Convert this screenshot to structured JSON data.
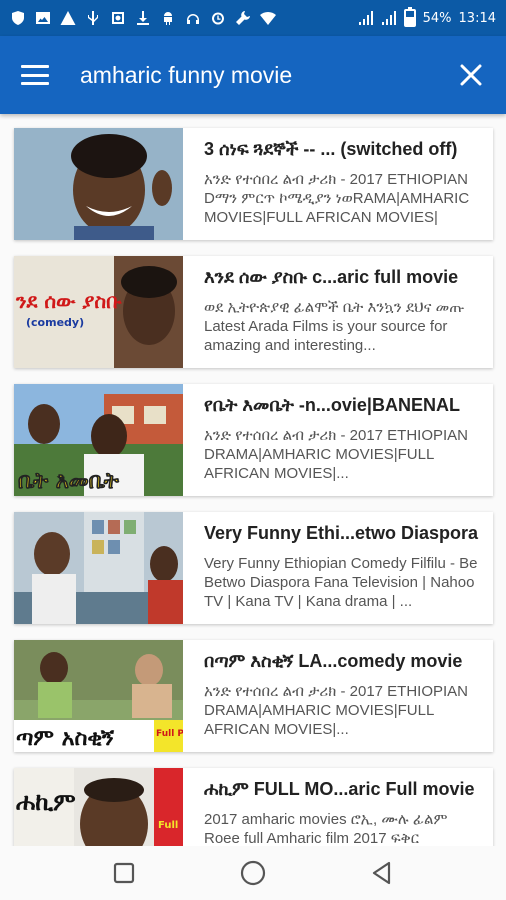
{
  "status_bar": {
    "battery_percent": "54%",
    "time": "13:14",
    "battery_level": 0.54,
    "icons": [
      "shield-icon",
      "image-icon",
      "warning-icon",
      "usb-icon",
      "instagram-icon",
      "download-icon",
      "android-icon",
      "headphones-icon",
      "alarm-icon",
      "wrench-icon",
      "wifi-icon",
      "signal-icon",
      "signal-icon",
      "charging-icon"
    ]
  },
  "app_bar": {
    "search_value": "amharic funny movie",
    "colors": {
      "status": "#0c5aa6",
      "bar": "#1565c0"
    }
  },
  "results": [
    {
      "title": "3 ሰነፍ ጓደኞች -- ... (switched off)",
      "description": "አንድ የተሰበረ ልብ ታሪክ - 2017 ETHIOPIAN Dማን ምርጥ ኮሜዲያን ነወRAMA|AMHARIC MOVIES|FULL AFRICAN MOVIES|",
      "thumb_overlay": ""
    },
    {
      "title": "እንደ ሰው ያስቡ c...aric full movie",
      "description": "ወደ ኢትዮጵያዊ ፊልሞች ቤት እንኳን ደህና መጡ Latest Arada Films is your source for amazing and interesting...",
      "thumb_overlay": "ንደ ሰው ያስቡ",
      "thumb_sub": "(comedy)"
    },
    {
      "title": "የቤት እመቤት -n...ovie|BANENAL",
      "description": "አንድ የተሰበረ ልብ ታሪክ - 2017 ETHIOPIAN DRAMA|AMHARIC MOVIES|FULL AFRICAN MOVIES|...",
      "thumb_overlay": "ቤት እመቤት"
    },
    {
      "title": "Very Funny Ethi...etwo Diaspora",
      "description": "Very Funny Ethiopian Comedy Filfilu - Be Betwo Diaspora Fana Television | Nahoo TV | Kana TV | Kana drama | ...",
      "thumb_overlay": ""
    },
    {
      "title": "በጣም እስቂኝ LA...comedy movie",
      "description": "አንድ የተሰበረ ልብ ታሪክ - 2017 ETHIOPIAN DRAMA|AMHARIC MOVIES|FULL AFRICAN MOVIES|...",
      "thumb_overlay": "ጣም አስቂኝ",
      "thumb_badge": "Full PART"
    },
    {
      "title": "ሐኪም FULL MO...aric Full movie",
      "description": "2017 amharic movies ሮኢ, ሙሉ ፊልም Roee full Amharic film 2017 ፍቅር",
      "thumb_overlay": "ሐኪም",
      "thumb_badge": "Full"
    }
  ],
  "nav_bar": {
    "icons": [
      "recents-square-icon",
      "home-circle-icon",
      "back-triangle-icon"
    ]
  }
}
